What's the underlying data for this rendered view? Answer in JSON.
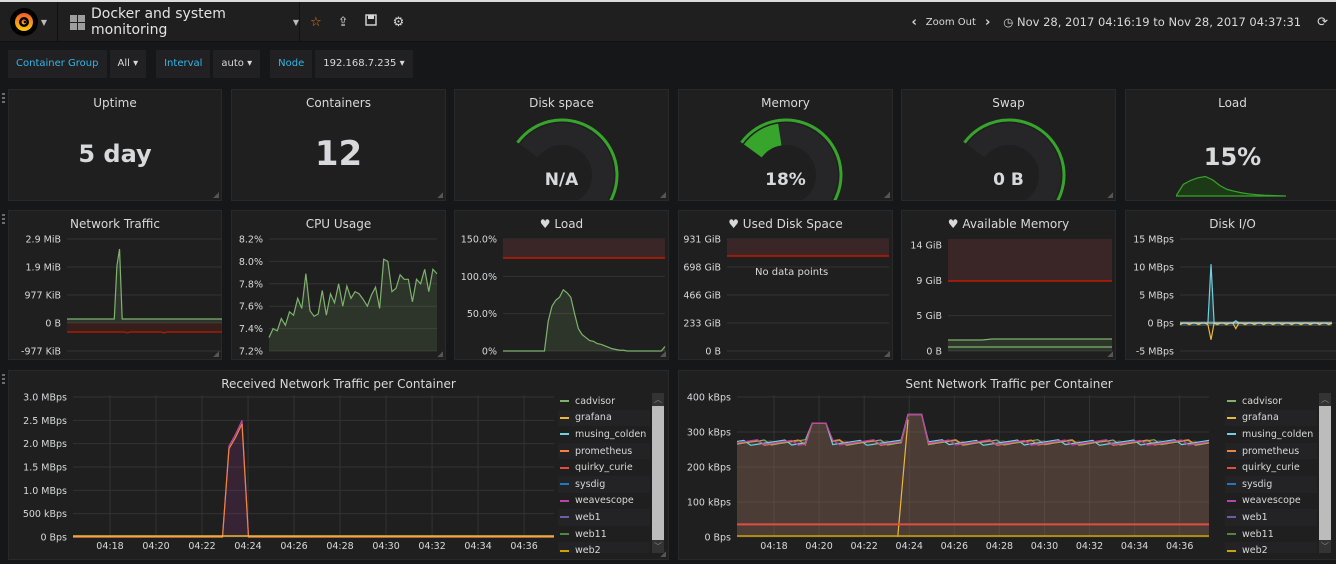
{
  "navbar": {
    "dashboard_title": "Docker and system monitoring",
    "icons": [
      "grafana-logo-icon",
      "star-icon",
      "share-icon",
      "save-icon",
      "gear-icon"
    ],
    "zoom_out_label": "Zoom Out",
    "time_range": "Nov 28, 2017 04:16:19 to Nov 28, 2017 04:37:31"
  },
  "variables": [
    {
      "label": "Container Group",
      "value": "All"
    },
    {
      "label": "Interval",
      "value": "auto"
    },
    {
      "label": "Node",
      "value": "192.168.7.235"
    }
  ],
  "colors": {
    "green": "#37a52b",
    "orange": "#e0752d",
    "red": "#e24d42",
    "link": "#33b5e5",
    "series_green": "#7eb26d"
  },
  "row1": {
    "uptime": {
      "title": "Uptime",
      "value": "5 day"
    },
    "containers": {
      "title": "Containers",
      "value": "12"
    },
    "disk_space": {
      "title": "Disk space",
      "value": "N/A",
      "fraction": 0
    },
    "memory": {
      "title": "Memory",
      "value": "18%",
      "fraction": 0.18
    },
    "swap": {
      "title": "Swap",
      "value": "0 B",
      "fraction": 0
    },
    "load": {
      "title": "Load",
      "value": "15%",
      "sparkline": [
        0,
        0.45,
        0.6,
        0.7,
        0.75,
        0.62,
        0.4,
        0.25,
        0.18,
        0.12,
        0.08,
        0.05,
        0.03,
        0.02,
        0.01,
        0
      ]
    }
  },
  "row2": {
    "network_traffic": {
      "title": "Network Traffic",
      "yticks": [
        "2.9 MiB",
        "1.9 MiB",
        "977 KiB",
        "0 B",
        "-977 KiB"
      ]
    },
    "cpu_usage": {
      "title": "CPU Usage",
      "yticks": [
        "8.2%",
        "8.0%",
        "7.8%",
        "7.6%",
        "7.4%",
        "7.2%"
      ]
    },
    "load": {
      "title": "Load",
      "yticks": [
        "150.0%",
        "100.0%",
        "50.0%",
        "0%"
      ],
      "threshold": 125
    },
    "used_disk_space": {
      "title": "Used Disk Space",
      "yticks": [
        "931 GiB",
        "698 GiB",
        "466 GiB",
        "233 GiB",
        "0 B"
      ],
      "no_data": "No data points"
    },
    "available_memory": {
      "title": "Available Memory",
      "yticks": [
        "14 GiB",
        "9 GiB",
        "5 GiB",
        "0 B"
      ]
    },
    "disk_io": {
      "title": "Disk I/O",
      "yticks": [
        "15 MBps",
        "10 MBps",
        "5 MBps",
        "0 Bps",
        "-5 MBps"
      ]
    }
  },
  "row3": {
    "received": {
      "title": "Received Network Traffic per Container",
      "yticks": [
        "3.0 MBps",
        "2.5 MBps",
        "2.0 MBps",
        "1.5 MBps",
        "1.0 MBps",
        "500 kBps",
        "0 Bps"
      ],
      "xticks": [
        "04:18",
        "04:20",
        "04:22",
        "04:24",
        "04:26",
        "04:28",
        "04:30",
        "04:32",
        "04:34",
        "04:36"
      ]
    },
    "sent": {
      "title": "Sent Network Traffic per Container",
      "yticks": [
        "400 kBps",
        "300 kBps",
        "200 kBps",
        "100 kBps",
        "0 Bps"
      ],
      "xticks": [
        "04:18",
        "04:20",
        "04:22",
        "04:24",
        "04:26",
        "04:28",
        "04:30",
        "04:32",
        "04:34",
        "04:36"
      ]
    },
    "legend": [
      {
        "name": "cadvisor",
        "color": "#7eb26d"
      },
      {
        "name": "grafana",
        "color": "#eab839"
      },
      {
        "name": "musing_colden",
        "color": "#6ed0e0"
      },
      {
        "name": "prometheus",
        "color": "#ef843c"
      },
      {
        "name": "quirky_curie",
        "color": "#e24d42"
      },
      {
        "name": "sysdig",
        "color": "#1f78c1"
      },
      {
        "name": "weavescope",
        "color": "#ba43a9"
      },
      {
        "name": "web1",
        "color": "#705da0"
      },
      {
        "name": "web11",
        "color": "#508642"
      },
      {
        "name": "web2",
        "color": "#cca300"
      }
    ]
  }
}
